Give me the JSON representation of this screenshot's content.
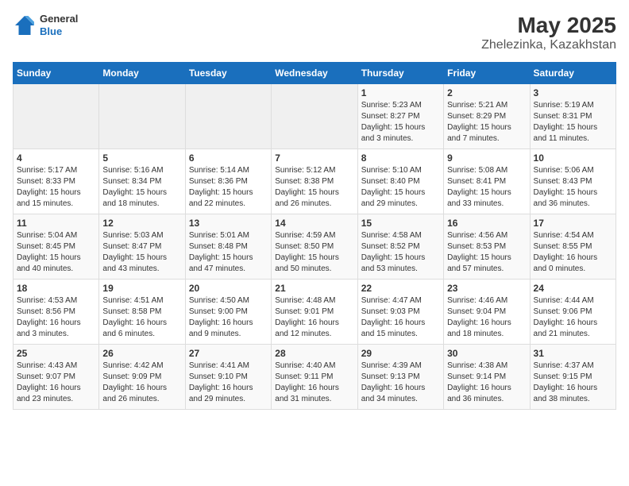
{
  "header": {
    "logo_general": "General",
    "logo_blue": "Blue",
    "title": "May 2025",
    "subtitle": "Zhelezinka, Kazakhstan"
  },
  "weekdays": [
    "Sunday",
    "Monday",
    "Tuesday",
    "Wednesday",
    "Thursday",
    "Friday",
    "Saturday"
  ],
  "weeks": [
    [
      {
        "day": "",
        "info": ""
      },
      {
        "day": "",
        "info": ""
      },
      {
        "day": "",
        "info": ""
      },
      {
        "day": "",
        "info": ""
      },
      {
        "day": "1",
        "info": "Sunrise: 5:23 AM\nSunset: 8:27 PM\nDaylight: 15 hours\nand 3 minutes."
      },
      {
        "day": "2",
        "info": "Sunrise: 5:21 AM\nSunset: 8:29 PM\nDaylight: 15 hours\nand 7 minutes."
      },
      {
        "day": "3",
        "info": "Sunrise: 5:19 AM\nSunset: 8:31 PM\nDaylight: 15 hours\nand 11 minutes."
      }
    ],
    [
      {
        "day": "4",
        "info": "Sunrise: 5:17 AM\nSunset: 8:33 PM\nDaylight: 15 hours\nand 15 minutes."
      },
      {
        "day": "5",
        "info": "Sunrise: 5:16 AM\nSunset: 8:34 PM\nDaylight: 15 hours\nand 18 minutes."
      },
      {
        "day": "6",
        "info": "Sunrise: 5:14 AM\nSunset: 8:36 PM\nDaylight: 15 hours\nand 22 minutes."
      },
      {
        "day": "7",
        "info": "Sunrise: 5:12 AM\nSunset: 8:38 PM\nDaylight: 15 hours\nand 26 minutes."
      },
      {
        "day": "8",
        "info": "Sunrise: 5:10 AM\nSunset: 8:40 PM\nDaylight: 15 hours\nand 29 minutes."
      },
      {
        "day": "9",
        "info": "Sunrise: 5:08 AM\nSunset: 8:41 PM\nDaylight: 15 hours\nand 33 minutes."
      },
      {
        "day": "10",
        "info": "Sunrise: 5:06 AM\nSunset: 8:43 PM\nDaylight: 15 hours\nand 36 minutes."
      }
    ],
    [
      {
        "day": "11",
        "info": "Sunrise: 5:04 AM\nSunset: 8:45 PM\nDaylight: 15 hours\nand 40 minutes."
      },
      {
        "day": "12",
        "info": "Sunrise: 5:03 AM\nSunset: 8:47 PM\nDaylight: 15 hours\nand 43 minutes."
      },
      {
        "day": "13",
        "info": "Sunrise: 5:01 AM\nSunset: 8:48 PM\nDaylight: 15 hours\nand 47 minutes."
      },
      {
        "day": "14",
        "info": "Sunrise: 4:59 AM\nSunset: 8:50 PM\nDaylight: 15 hours\nand 50 minutes."
      },
      {
        "day": "15",
        "info": "Sunrise: 4:58 AM\nSunset: 8:52 PM\nDaylight: 15 hours\nand 53 minutes."
      },
      {
        "day": "16",
        "info": "Sunrise: 4:56 AM\nSunset: 8:53 PM\nDaylight: 15 hours\nand 57 minutes."
      },
      {
        "day": "17",
        "info": "Sunrise: 4:54 AM\nSunset: 8:55 PM\nDaylight: 16 hours\nand 0 minutes."
      }
    ],
    [
      {
        "day": "18",
        "info": "Sunrise: 4:53 AM\nSunset: 8:56 PM\nDaylight: 16 hours\nand 3 minutes."
      },
      {
        "day": "19",
        "info": "Sunrise: 4:51 AM\nSunset: 8:58 PM\nDaylight: 16 hours\nand 6 minutes."
      },
      {
        "day": "20",
        "info": "Sunrise: 4:50 AM\nSunset: 9:00 PM\nDaylight: 16 hours\nand 9 minutes."
      },
      {
        "day": "21",
        "info": "Sunrise: 4:48 AM\nSunset: 9:01 PM\nDaylight: 16 hours\nand 12 minutes."
      },
      {
        "day": "22",
        "info": "Sunrise: 4:47 AM\nSunset: 9:03 PM\nDaylight: 16 hours\nand 15 minutes."
      },
      {
        "day": "23",
        "info": "Sunrise: 4:46 AM\nSunset: 9:04 PM\nDaylight: 16 hours\nand 18 minutes."
      },
      {
        "day": "24",
        "info": "Sunrise: 4:44 AM\nSunset: 9:06 PM\nDaylight: 16 hours\nand 21 minutes."
      }
    ],
    [
      {
        "day": "25",
        "info": "Sunrise: 4:43 AM\nSunset: 9:07 PM\nDaylight: 16 hours\nand 23 minutes."
      },
      {
        "day": "26",
        "info": "Sunrise: 4:42 AM\nSunset: 9:09 PM\nDaylight: 16 hours\nand 26 minutes."
      },
      {
        "day": "27",
        "info": "Sunrise: 4:41 AM\nSunset: 9:10 PM\nDaylight: 16 hours\nand 29 minutes."
      },
      {
        "day": "28",
        "info": "Sunrise: 4:40 AM\nSunset: 9:11 PM\nDaylight: 16 hours\nand 31 minutes."
      },
      {
        "day": "29",
        "info": "Sunrise: 4:39 AM\nSunset: 9:13 PM\nDaylight: 16 hours\nand 34 minutes."
      },
      {
        "day": "30",
        "info": "Sunrise: 4:38 AM\nSunset: 9:14 PM\nDaylight: 16 hours\nand 36 minutes."
      },
      {
        "day": "31",
        "info": "Sunrise: 4:37 AM\nSunset: 9:15 PM\nDaylight: 16 hours\nand 38 minutes."
      }
    ]
  ]
}
